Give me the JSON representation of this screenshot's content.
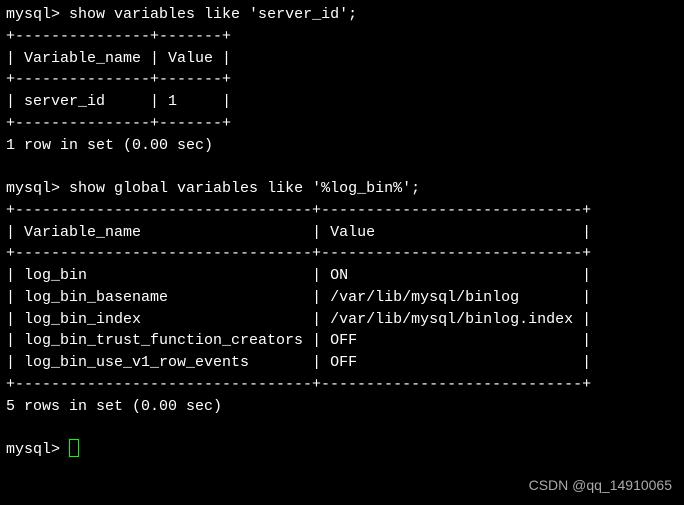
{
  "prompt": "mysql>",
  "query1": {
    "sql": "show variables like 'server_id';",
    "headers": {
      "col1": "Variable_name",
      "col2": "Value"
    },
    "rows": [
      {
        "name": "server_id",
        "value": "1"
      }
    ],
    "footer": "1 row in set (0.00 sec)"
  },
  "query2": {
    "sql": "show global variables like '%log_bin%';",
    "headers": {
      "col1": "Variable_name",
      "col2": "Value"
    },
    "rows": [
      {
        "name": "log_bin",
        "value": "ON"
      },
      {
        "name": "log_bin_basename",
        "value": "/var/lib/mysql/binlog"
      },
      {
        "name": "log_bin_index",
        "value": "/var/lib/mysql/binlog.index"
      },
      {
        "name": "log_bin_trust_function_creators",
        "value": "OFF"
      },
      {
        "name": "log_bin_use_v1_row_events",
        "value": "OFF"
      }
    ],
    "footer": "5 rows in set (0.00 sec)"
  },
  "table1_layout": {
    "border": "+---------------+-------+",
    "header": "| Variable_name | Value |",
    "row_fmt_widths": [
      13,
      5
    ]
  },
  "table2_layout": {
    "border": "+---------------------------------+-----------------------------+",
    "col1_width": 31,
    "col2_width": 27
  },
  "watermark": "CSDN @qq_14910065"
}
